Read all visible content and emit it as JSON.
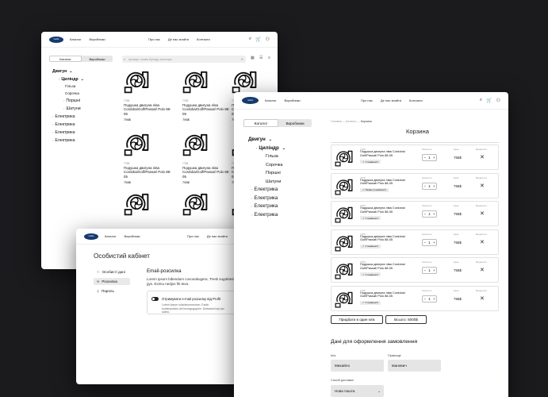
{
  "nav": {
    "logo_text": "mahle",
    "catalog": "Каталог",
    "manufacturers": "Виробники",
    "about": "Про нас",
    "where_find": "Де нас знайти",
    "contacts": "Контакти"
  },
  "catalog_page": {
    "tab_catalog": "Каталог",
    "tab_manufacturers": "Виробники",
    "search_placeholder": "Артикул, назва бренду, категорія",
    "tree": [
      {
        "label": "Двигун"
      },
      {
        "label": "Циліндр"
      },
      {
        "label": "Гільза"
      },
      {
        "label": "Сорочка"
      },
      {
        "label": "Поршні"
      },
      {
        "label": "Шатуни"
      },
      {
        "label": "Електрика"
      },
      {
        "label": "Електрика"
      },
      {
        "label": "Електрика"
      },
      {
        "label": "Електрика"
      }
    ],
    "products": [
      {
        "code": "7765",
        "name": "Подушка двигуна ліва Cordoba/Golf/Passat/ Polo 88-05",
        "price": "756$"
      },
      {
        "code": "7765",
        "name": "Подушка двигуна ліва Cordoba/Golf/Passat/ Polo 88-05",
        "price": "756$"
      },
      {
        "code": "7765",
        "name": "Подушка двигуна ліва Cordoba/Golf/Passat/ Polo 88-05",
        "price": "756$"
      },
      {
        "code": "7765",
        "name": "Подушка двигуна ліва Cordoba/Golf/Passat/ Polo 88-05",
        "price": "756$"
      },
      {
        "code": "7765",
        "name": "Подушка двигуна ліва Cordoba/Golf/Passat/ Polo 88-05",
        "price": "756$"
      },
      {
        "code": "7765",
        "name": "Подушка двигуна ліва Cordoba/Golf/Passat/ Polo 88-05",
        "price": "756$"
      }
    ]
  },
  "cabinet_page": {
    "title": "Особистий кабінет",
    "menu": [
      "Особисті дані",
      "Розсилка",
      "Пароль"
    ],
    "email_heading": "Email-розсилка",
    "email_text": "Lorem ipsum bibendum covonakugera, Tresk sugdeteslarna i gys. Eximu nedjus fik teva.",
    "toggle_label": "Отримувати e-mail розсилку від Profit",
    "toggle_desc": "Lorem ipsum soladeconsectum. Eadio kontenpoides del bromgugapeln. Dretsklod byd jan salmo."
  },
  "cart_page": {
    "tab_catalog": "Каталог",
    "tab_manufacturers": "Виробники",
    "tree": [
      {
        "label": "Двигун"
      },
      {
        "label": "Циліндр"
      },
      {
        "label": "Гільза"
      },
      {
        "label": "Сорочка"
      },
      {
        "label": "Поршні"
      },
      {
        "label": "Шатуни"
      },
      {
        "label": "Електрика"
      },
      {
        "label": "Електрика"
      },
      {
        "label": "Електрика"
      },
      {
        "label": "Електрика"
      }
    ],
    "breadcrumbs": {
      "home": "Головна",
      "catalog": "Каталог",
      "current": "Корзина"
    },
    "title": "Корзина",
    "col_qty": "Кількість",
    "col_price": "Ціна",
    "col_delete": "Видалити",
    "items": [
      {
        "code": "7765",
        "name": "Подушка двигуна ліва Cordoba/ Golf/Passat/ Polo 88-05",
        "badge": "✓ У наявності",
        "qty": "1",
        "price": "756$"
      },
      {
        "code": "7765",
        "name": "Подушка двигуна ліва Cordoba/ Golf/Passat/ Polo 88-05",
        "badge": "✓ Немає в наявності",
        "qty": "1",
        "price": "756$"
      },
      {
        "code": "7765",
        "name": "Подушка двигуна ліва Cordoba/ Golf/Passat/ Polo 88-05",
        "badge": "✓ У наявності",
        "qty": "1",
        "price": "756$"
      },
      {
        "code": "7765",
        "name": "Подушка двигуна ліва Cordoba/ Golf/Passat/ Polo 88-05",
        "badge": "✓ У наявності",
        "qty": "1",
        "price": "756$"
      },
      {
        "code": "7765",
        "name": "Подушка двигуна ліва Cordoba/ Golf/Passat/ Polo 88-05",
        "badge": "✓ У наявності",
        "qty": "1",
        "price": "756$"
      },
      {
        "code": "7765",
        "name": "Подушка двигуна ліва Cordoba/ Golf/Passat/ Polo 88-05",
        "badge": "✓ У наявності",
        "qty": "1",
        "price": "756$"
      }
    ],
    "buy_one_click": "Придбати в один клік",
    "total": "Всього: 5000$",
    "order_title": "Дані для оформлення замовлення",
    "name_label": "Ім'я",
    "name_value": "Михайло",
    "surname_label": "Прізвище",
    "surname_value": "Іванович",
    "delivery_label": "Спосіб доставки",
    "delivery_value": "Нова пошта"
  }
}
